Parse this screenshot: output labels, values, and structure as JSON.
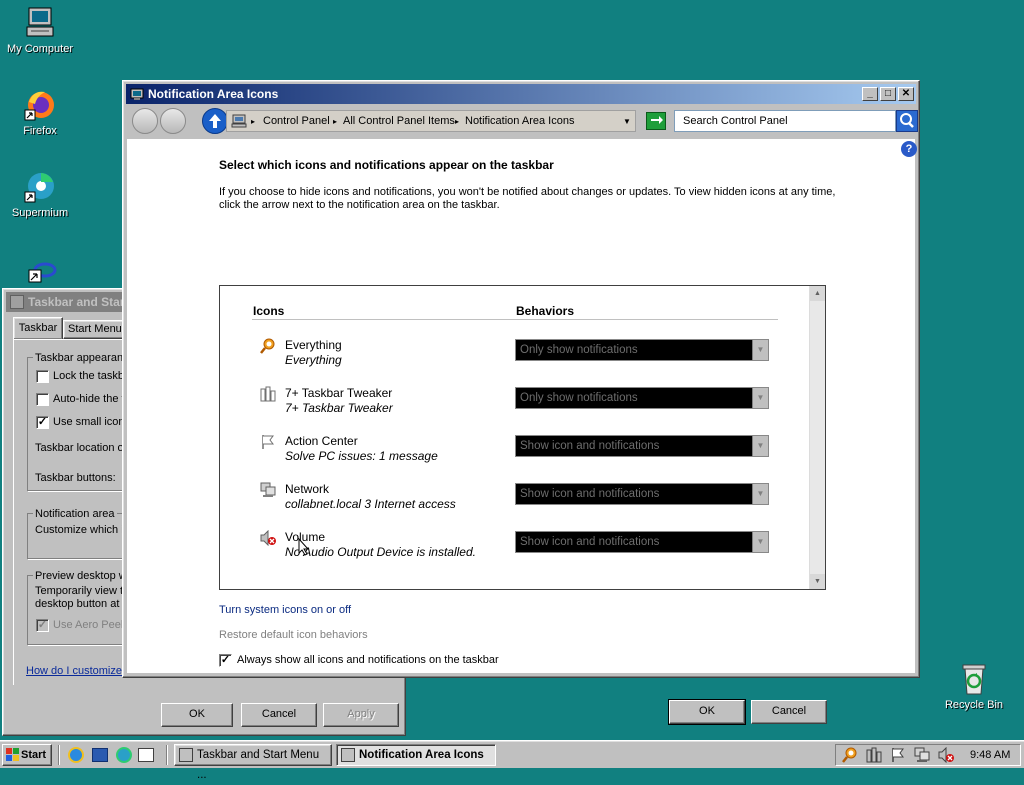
{
  "desktop": {
    "icons": [
      {
        "label": "My Computer"
      },
      {
        "label": "Firefox"
      },
      {
        "label": "Supermium"
      },
      {
        "label": "Recycle Bin"
      }
    ]
  },
  "back_window": {
    "title": "Taskbar and Start Menu Properties",
    "tabs": [
      "Taskbar",
      "Start Menu"
    ],
    "group_appearance": "Taskbar appearance",
    "lock_label": "Lock the taskbar",
    "autohide_label": "Auto-hide the taskbar",
    "small_icons_label": "Use small icons",
    "location_label": "Taskbar location on screen:",
    "buttons_label": "Taskbar buttons:",
    "group_notification": "Notification area",
    "notification_text": "Customize which icons and notifications appear in the notification area.",
    "group_preview": "Preview desktop with Aero Peek",
    "preview_text": "Temporarily view the desktop when you move your mouse to the Show desktop button at end of the taskbar.",
    "aero_peek_label": "Use Aero Peek to preview the desktop",
    "help_link": "How do I customize the taskbar?",
    "ok": "OK",
    "cancel": "Cancel",
    "apply": "Apply"
  },
  "main_window": {
    "title": "Notification Area Icons",
    "breadcrumb": [
      "Control Panel",
      "All Control Panel Items",
      "Notification Area Icons"
    ],
    "search_placeholder": "Search Control Panel",
    "heading": "Select which icons and notifications appear on the taskbar",
    "description_line1": "If you choose to hide icons and notifications, you won't be notified about changes or updates. To view hidden icons at any time,",
    "description_line2": "click the arrow next to the notification area on the taskbar.",
    "col_icons": "Icons",
    "col_behaviors": "Behaviors",
    "rows": [
      {
        "name": "Everything",
        "sub": "Everything",
        "behavior": "Only show notifications",
        "icon": "search-icon"
      },
      {
        "name": "7+ Taskbar Tweaker",
        "sub": "7+ Taskbar Tweaker",
        "behavior": "Only show notifications",
        "icon": "tweaker-icon"
      },
      {
        "name": "Action Center",
        "sub": "Solve PC issues: 1 message",
        "behavior": "Show icon and notifications",
        "icon": "flag-icon"
      },
      {
        "name": "Network",
        "sub": "collabnet.local  3 Internet access",
        "behavior": "Show icon and notifications",
        "icon": "network-icon"
      },
      {
        "name": "Volume",
        "sub": "No Audio Output Device is installed.",
        "behavior": "Show icon and notifications",
        "icon": "volume-muted-icon"
      }
    ],
    "link_system_icons": "Turn system icons on or off",
    "link_restore": "Restore default icon behaviors",
    "always_show_label": "Always show all icons and notifications on the taskbar",
    "always_show_checked": true,
    "ok": "OK",
    "cancel": "Cancel"
  },
  "taskbar": {
    "start_label": "Start",
    "tasks": [
      "Taskbar and Start Menu ...",
      "Notification Area Icons"
    ],
    "clock": "9:48 AM"
  }
}
